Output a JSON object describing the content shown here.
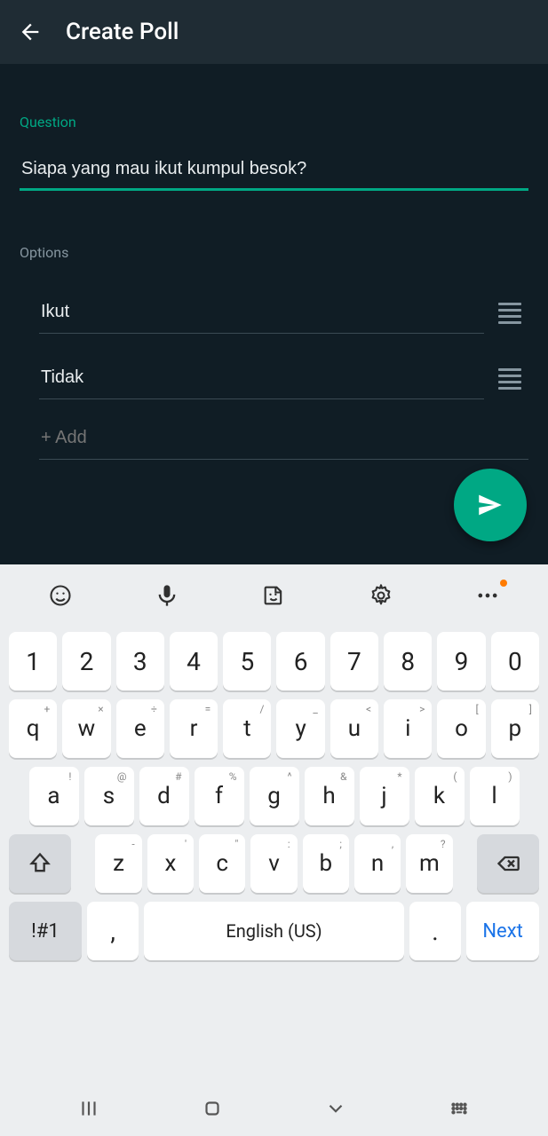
{
  "appbar": {
    "title": "Create Poll"
  },
  "question": {
    "label": "Question",
    "value": "Siapa yang mau ikut kumpul besok?"
  },
  "options": {
    "label": "Options",
    "items": [
      {
        "value": "Ikut"
      },
      {
        "value": "Tidak"
      }
    ],
    "add_placeholder": "+ Add"
  },
  "keyboard": {
    "rows": {
      "numbers": [
        "1",
        "2",
        "3",
        "4",
        "5",
        "6",
        "7",
        "8",
        "9",
        "0"
      ],
      "row1": [
        {
          "k": "q",
          "h": "+"
        },
        {
          "k": "w",
          "h": "×"
        },
        {
          "k": "e",
          "h": "÷"
        },
        {
          "k": "r",
          "h": "="
        },
        {
          "k": "t",
          "h": "/"
        },
        {
          "k": "y",
          "h": "_"
        },
        {
          "k": "u",
          "h": "<"
        },
        {
          "k": "i",
          "h": ">"
        },
        {
          "k": "o",
          "h": "["
        },
        {
          "k": "p",
          "h": "]"
        }
      ],
      "row2": [
        {
          "k": "a",
          "h": "!"
        },
        {
          "k": "s",
          "h": "@"
        },
        {
          "k": "d",
          "h": "#"
        },
        {
          "k": "f",
          "h": "%"
        },
        {
          "k": "g",
          "h": "^"
        },
        {
          "k": "h",
          "h": "&"
        },
        {
          "k": "j",
          "h": "*"
        },
        {
          "k": "k",
          "h": "("
        },
        {
          "k": "l",
          "h": ")"
        }
      ],
      "row3": [
        {
          "k": "z",
          "h": "-"
        },
        {
          "k": "x",
          "h": "'"
        },
        {
          "k": "c",
          "h": "\""
        },
        {
          "k": "v",
          "h": ":"
        },
        {
          "k": "b",
          "h": ";"
        },
        {
          "k": "n",
          "h": ","
        },
        {
          "k": "m",
          "h": "?"
        }
      ]
    },
    "sym": "!#1",
    "comma": ",",
    "space": "English (US)",
    "period": ".",
    "next": "Next"
  }
}
